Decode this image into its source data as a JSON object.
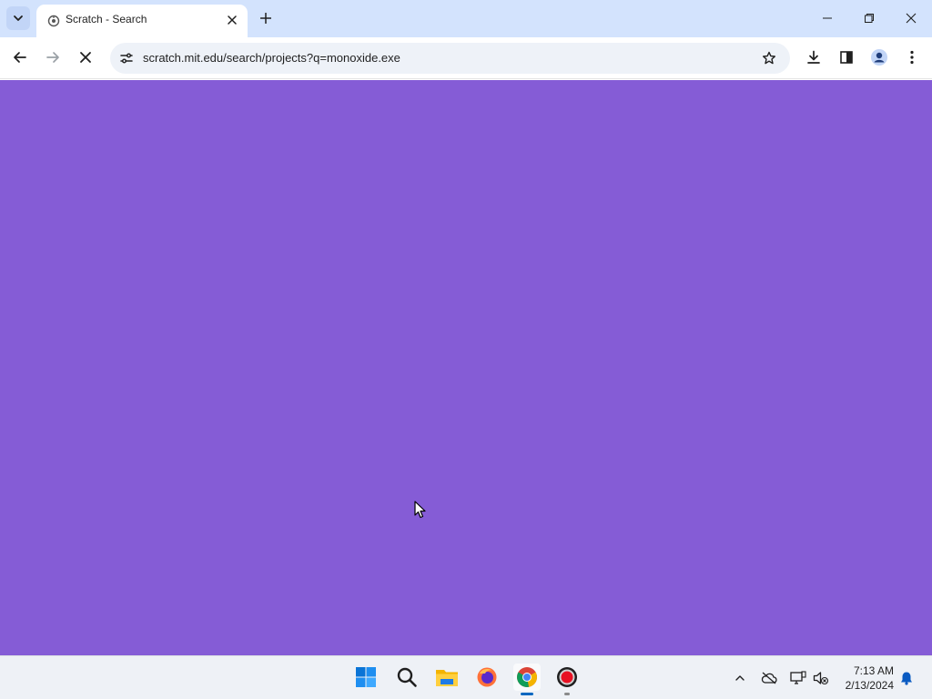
{
  "browser": {
    "tab": {
      "title": "Scratch - Search",
      "favicon": "scratch-icon"
    },
    "address_bar": {
      "url": "scratch.mit.edu/search/projects?q=monoxide.exe"
    },
    "loading": true
  },
  "page": {
    "background_color": "#855cd6"
  },
  "taskbar": {
    "apps": [
      "start-icon",
      "search-icon",
      "file-explorer-icon",
      "firefox-icon",
      "chrome-icon",
      "recorder-icon"
    ],
    "clock": {
      "time": "7:13 AM",
      "date": "2/13/2024"
    }
  },
  "colors": {
    "tabstrip": "#d3e3fd",
    "accent": "#0067c0",
    "page_bg": "#855cd6"
  }
}
